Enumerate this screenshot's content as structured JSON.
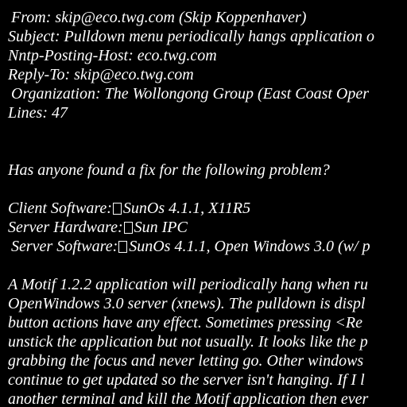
{
  "colors": {
    "background": "#000000",
    "text": "#ffffff"
  },
  "header": {
    "from": "From: skip@eco.twg.com (Skip Koppenhaver)",
    "subject": "Subject: Pulldown menu periodically hangs application o",
    "nntp_posting_host": "Nntp-Posting-Host: eco.twg.com",
    "reply_to": "Reply-To: skip@eco.twg.com",
    "organization": "Organization: The Wollongong Group (East Coast Oper",
    "lines": "Lines: 47"
  },
  "body": {
    "question": "Has anyone found a fix for the following problem?",
    "specs": {
      "client_label": "Client Software:",
      "client_value": "SunOs 4.1.1, X11R5",
      "server_hw_label": "Server Hardware:",
      "server_hw_value": "Sun IPC",
      "server_sw_label": "Server Software:",
      "server_sw_value": "SunOs 4.1.1, Open Windows 3.0 (w/ p"
    },
    "paragraph": [
      "A Motif 1.2.2 application will periodically hang when ru",
      "OpenWindows 3.0 server (xnews). The pulldown is displ",
      "button actions have any effect. Sometimes pressing <Re",
      "unstick the application but not usually. It looks like the p",
      "grabbing the focus and never letting go. Other windows",
      "continue to get updated so the server isn't hanging. If I l",
      "another terminal and kill the Motif application then ever"
    ]
  }
}
